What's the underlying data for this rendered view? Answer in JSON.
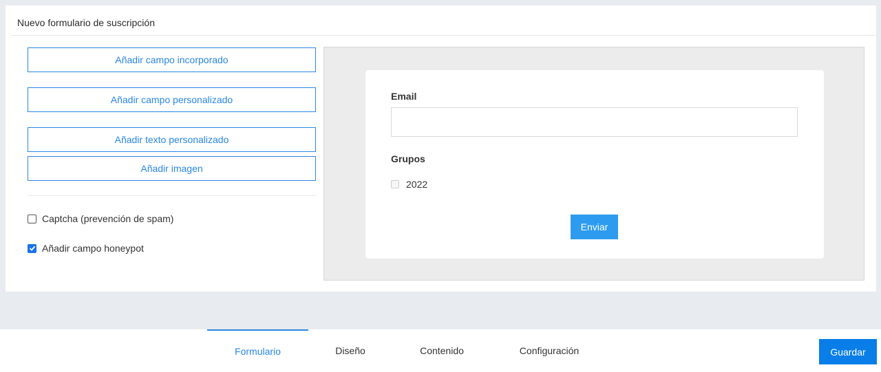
{
  "card": {
    "title": "Nuevo formulario de suscripción"
  },
  "left_panel": {
    "buttons": [
      {
        "label": "Añadir campo incorporado"
      },
      {
        "label": "Añadir campo personalizado"
      },
      {
        "label": "Añadir texto personalizado"
      },
      {
        "label": "Añadir imagen"
      }
    ],
    "options": [
      {
        "label": "Captcha (prevención de spam)",
        "checked": false
      },
      {
        "label": "Añadir campo honeypot",
        "checked": true
      }
    ]
  },
  "preview": {
    "email_label": "Email",
    "email_value": "",
    "groups_label": "Grupos",
    "groups": [
      {
        "label": "2022",
        "checked": false
      }
    ],
    "submit_label": "Enviar"
  },
  "bottom_bar": {
    "tabs": [
      {
        "label": "Formulario",
        "active": true
      },
      {
        "label": "Diseño",
        "active": false
      },
      {
        "label": "Contenido",
        "active": false
      },
      {
        "label": "Configuración",
        "active": false
      }
    ],
    "save_label": "Guardar"
  },
  "colors": {
    "accent": "#2a86e5",
    "save": "#0a7ee8",
    "submit": "#2d9cf0",
    "background": "#e8ebef"
  }
}
